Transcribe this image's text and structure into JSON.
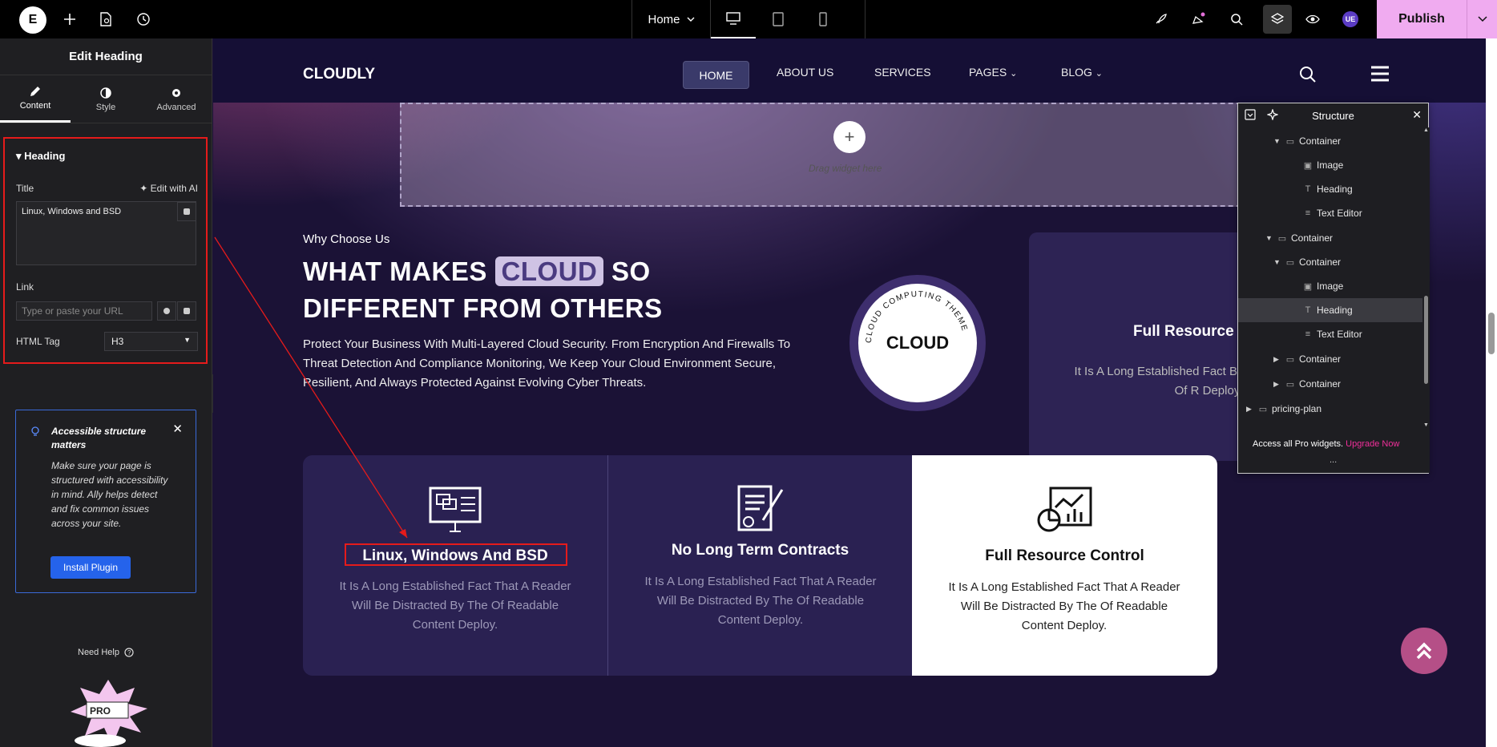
{
  "topbar": {
    "logo": "E",
    "page_name": "Home",
    "publish_label": "Publish",
    "avatar_initials": "UE"
  },
  "panel": {
    "title": "Edit Heading",
    "tabs": [
      {
        "label": "Content",
        "icon": "pencil-icon"
      },
      {
        "label": "Style",
        "icon": "half-circle-icon"
      },
      {
        "label": "Advanced",
        "icon": "gear-icon"
      }
    ],
    "section_title": "Heading",
    "title_label": "Title",
    "edit_ai_label": "Edit with AI",
    "title_value": "Linux, Windows and BSD",
    "link_label": "Link",
    "link_placeholder": "Type or paste your URL",
    "html_tag_label": "HTML Tag",
    "html_tag_value": "H3",
    "notice_title": "Accessible structure matters",
    "notice_body": "Make sure your page is structured with accessibility in mind. Ally helps detect and fix common issues across your site.",
    "install_label": "Install Plugin",
    "help_label": "Need Help"
  },
  "site": {
    "brand": "CLOUDLY",
    "nav": [
      "HOME",
      "ABOUT US",
      "SERVICES",
      "PAGES",
      "BLOG"
    ],
    "dropzone_text": "Drag widget here",
    "eyebrow": "Why Choose Us",
    "title_part1": "WHAT MAKES",
    "title_highlight": "CLOUD",
    "title_part2": "SO DIFFERENT FROM OTHERS",
    "lead": "Protect Your Business With Multi-Layered Cloud Security. From Encryption And Firewalls To Threat Detection And Compliance Monitoring, We Keep Your Cloud Environment Secure, Resilient, And Always Protected Against Evolving Cyber Threats.",
    "badge_text": "CLOUD",
    "badge_ring": "CLOUD COMPUTING THEME",
    "right_card_title": "Full Resource C",
    "right_card_text": "It Is A Long Established Fact Be Distracted By The Of R Deploy.",
    "cards": [
      {
        "title": "Linux, Windows And BSD",
        "text": "It Is A Long Established Fact That A Reader Will Be Distracted By The Of Readable Content Deploy."
      },
      {
        "title": "No Long Term Contracts",
        "text": "It Is A Long Established Fact That A Reader Will Be Distracted By The Of Readable Content Deploy."
      },
      {
        "title": "Full Resource Control",
        "text": "It Is A Long Established Fact That A Reader Will Be Distracted By The Of Readable Content Deploy."
      }
    ]
  },
  "structure": {
    "title": "Structure",
    "rows": [
      {
        "label": "Container",
        "caret": "▼",
        "icon": "container-icon",
        "highlight": false
      },
      {
        "label": "Image",
        "caret": "",
        "icon": "image-icon",
        "highlight": false
      },
      {
        "label": "Heading",
        "caret": "",
        "icon": "heading-icon",
        "highlight": false
      },
      {
        "label": "Text Editor",
        "caret": "",
        "icon": "text-editor-icon",
        "highlight": false
      },
      {
        "label": "Container",
        "caret": "▼",
        "icon": "container-icon",
        "highlight": false
      },
      {
        "label": "Container",
        "caret": "▼",
        "icon": "container-icon",
        "highlight": false
      },
      {
        "label": "Image",
        "caret": "",
        "icon": "image-icon",
        "highlight": false
      },
      {
        "label": "Heading",
        "caret": "",
        "icon": "heading-icon",
        "highlight": true
      },
      {
        "label": "Text Editor",
        "caret": "",
        "icon": "text-editor-icon",
        "highlight": false
      },
      {
        "label": "Container",
        "caret": "▶",
        "icon": "container-icon",
        "highlight": false
      },
      {
        "label": "Container",
        "caret": "▶",
        "icon": "container-icon",
        "highlight": false
      },
      {
        "label": "pricing-plan",
        "caret": "▶",
        "icon": "container-icon",
        "highlight": false
      }
    ],
    "footer_text": "Access all Pro widgets.",
    "upgrade_label": "Upgrade Now",
    "footer_dots": "..."
  }
}
